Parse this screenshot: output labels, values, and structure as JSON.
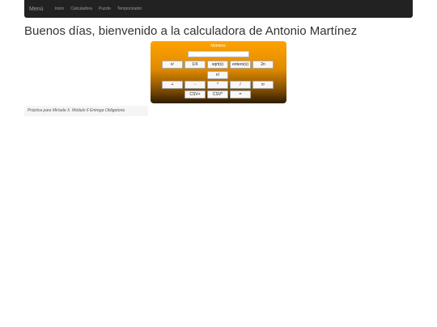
{
  "navbar": {
    "brand": "Menú",
    "links": [
      "Inicio",
      "Calculadora",
      "Puzzle",
      "Temporizador"
    ]
  },
  "page_title": "Buenos días, bienvenido a la calculadora de Antonio Martínez",
  "calculator": {
    "label": "Número:",
    "input_value": "",
    "buttons": {
      "square": "x²",
      "inverse": "1/X",
      "sqrt": "sqrt(x)",
      "integer": "entero(x)",
      "pow2": "2n",
      "factorial": "n!",
      "add": "+",
      "subtract": "-",
      "multiply": "*",
      "divide": "/",
      "power": "xʸ",
      "csv_sum": "CSV+",
      "csv_mul": "CSV*",
      "equals": "="
    }
  },
  "footer": "Práctica para Miríada X. Módulo 6 Entrega Obligatoria"
}
